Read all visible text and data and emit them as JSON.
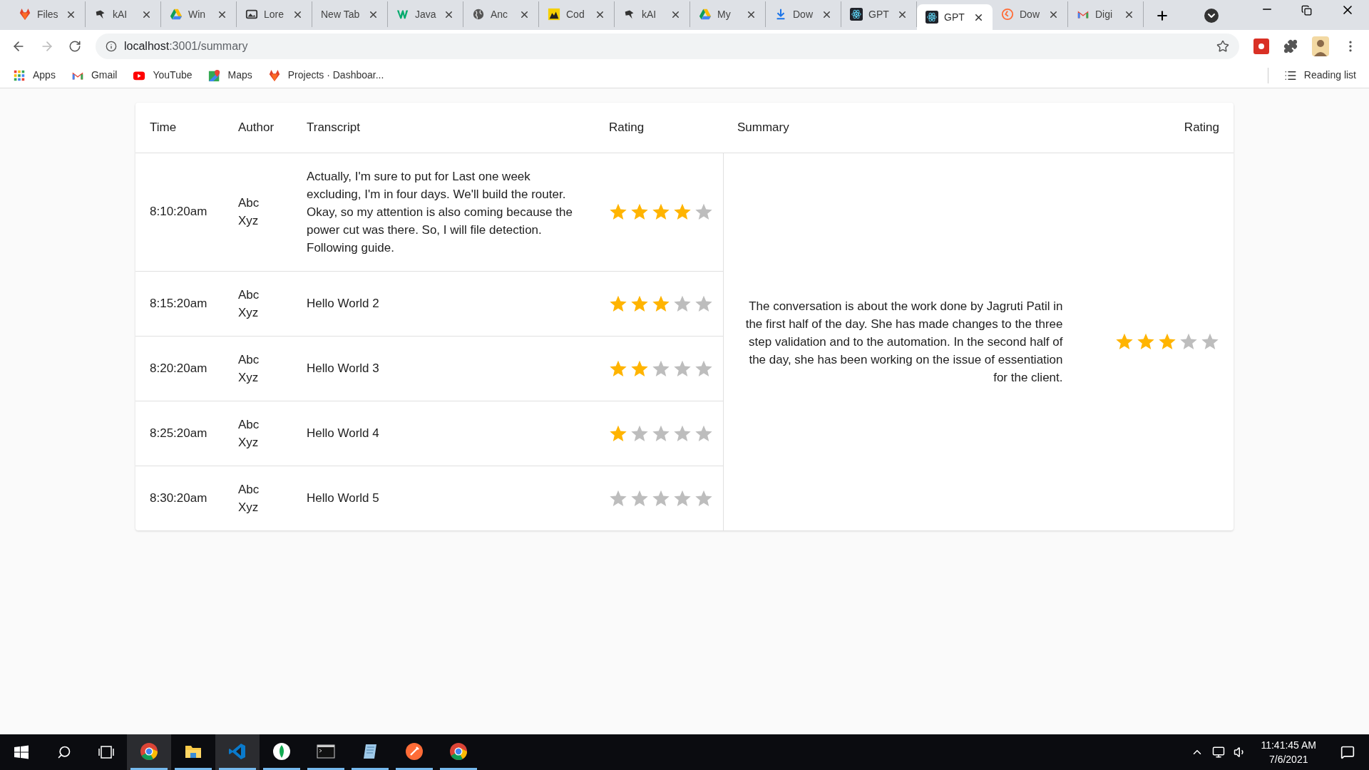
{
  "browser": {
    "tabs": [
      {
        "label": "Files",
        "kind": "fox",
        "selected": false
      },
      {
        "label": "kAI",
        "kind": "bird",
        "selected": false
      },
      {
        "label": "Win",
        "kind": "drive",
        "selected": false
      },
      {
        "label": "Lore",
        "kind": "image",
        "selected": false
      },
      {
        "label": "New Tab",
        "kind": "none",
        "selected": false
      },
      {
        "label": "Java",
        "kind": "w3",
        "selected": false
      },
      {
        "label": "Anc",
        "kind": "globe",
        "selected": false
      },
      {
        "label": "Cod",
        "kind": "yellow",
        "selected": false
      },
      {
        "label": "kAI",
        "kind": "bird",
        "selected": false
      },
      {
        "label": "My",
        "kind": "drive",
        "selected": false
      },
      {
        "label": "Dow",
        "kind": "download",
        "selected": false
      },
      {
        "label": "GPT",
        "kind": "react",
        "selected": false
      },
      {
        "label": "GPT",
        "kind": "react",
        "selected": true
      },
      {
        "label": "Dow",
        "kind": "clock",
        "selected": false
      },
      {
        "label": "Digi",
        "kind": "gmail",
        "selected": false
      }
    ],
    "url_host": "localhost",
    "url_path": ":3001/summary",
    "bookmarks": [
      {
        "label": "Apps",
        "kind": "apps"
      },
      {
        "label": "Gmail",
        "kind": "gmail"
      },
      {
        "label": "YouTube",
        "kind": "youtube"
      },
      {
        "label": "Maps",
        "kind": "maps"
      },
      {
        "label": "Projects · Dashboar...",
        "kind": "fox"
      }
    ],
    "reading_list": "Reading list"
  },
  "table": {
    "columns": [
      "Time",
      "Author",
      "Transcript",
      "Rating",
      "Summary",
      "Rating"
    ],
    "rows": [
      {
        "time": "8:10:20am",
        "author": "Abc Xyz",
        "transcript": "Actually, I'm sure to put for Last one week excluding, I'm in four days. We'll build the router. Okay, so my attention is also coming because the power cut was there. So, I will file detection. Following guide.",
        "stars": 4
      },
      {
        "time": "8:15:20am",
        "author": "Abc Xyz",
        "transcript": "Hello World 2",
        "stars": 3
      },
      {
        "time": "8:20:20am",
        "author": "Abc Xyz",
        "transcript": "Hello World 3",
        "stars": 2
      },
      {
        "time": "8:25:20am",
        "author": "Abc Xyz",
        "transcript": "Hello World 4",
        "stars": 1
      },
      {
        "time": "8:30:20am",
        "author": "Abc Xyz",
        "transcript": "Hello World 5",
        "stars": 0
      }
    ],
    "summary": {
      "text": "The conversation is about the work done by Jagruti Patil in the first half of the day. She has made changes to the three step validation and to the automation. In the second half of the day, she has been working on the issue of essentiation for the client.",
      "stars": 3
    }
  },
  "taskbar": {
    "apps": [
      {
        "kind": "chrome",
        "active": true,
        "selected": true
      },
      {
        "kind": "folder",
        "active": true,
        "selected": false
      },
      {
        "kind": "vscode",
        "active": true,
        "selected": true
      },
      {
        "kind": "leaf",
        "active": true,
        "selected": false
      },
      {
        "kind": "terminal",
        "active": true,
        "selected": false
      },
      {
        "kind": "notepad",
        "active": true,
        "selected": false
      },
      {
        "kind": "postman",
        "active": true,
        "selected": false
      },
      {
        "kind": "chrome",
        "active": true,
        "selected": false
      }
    ],
    "time": "11:41:45 AM",
    "date": "7/6/2021"
  }
}
